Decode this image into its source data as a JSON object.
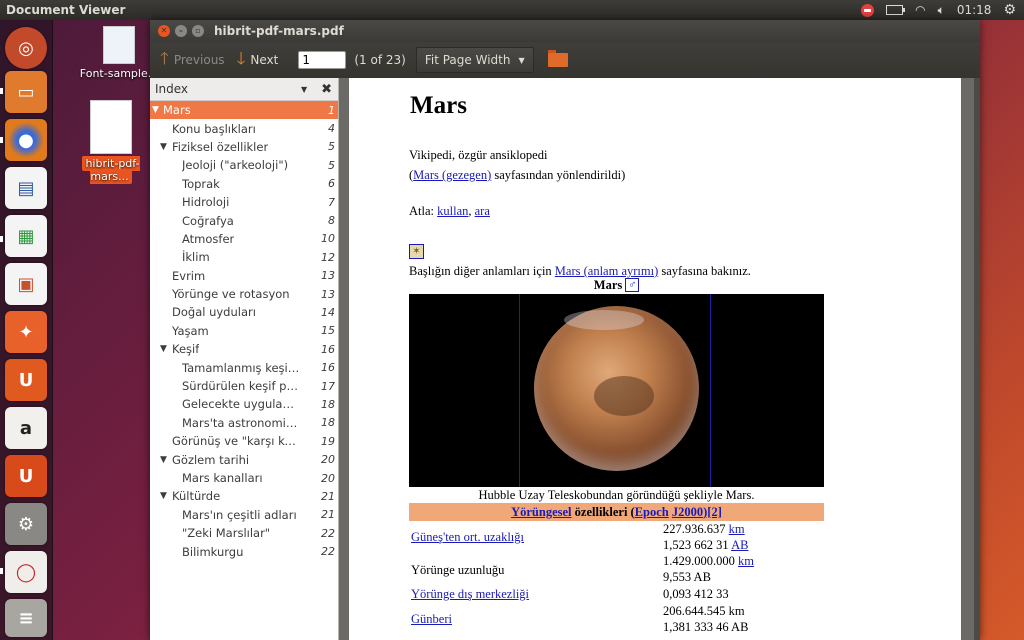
{
  "top_panel": {
    "app_title": "Document Viewer",
    "clock": "01:18"
  },
  "desktop": {
    "icons": [
      {
        "label": "Font-sample..."
      },
      {
        "label": "hibrit-pdf-mars..."
      }
    ]
  },
  "window": {
    "title": "hibrit-pdf-mars.pdf",
    "toolbar": {
      "previous_label": "Previous",
      "next_label": "Next",
      "page_value": "1",
      "page_count": "(1 of 23)",
      "zoom_label": "Fit Page Width"
    },
    "sidebar": {
      "header_label": "Index",
      "items": [
        {
          "label": "Mars",
          "page": "1",
          "level": 0,
          "expander": "▼",
          "selected": true
        },
        {
          "label": "Konu başlıkları",
          "page": "4",
          "level": 1,
          "expander": ""
        },
        {
          "label": "Fiziksel özellikler",
          "page": "5",
          "level": 1,
          "expander": "▼"
        },
        {
          "label": "Jeoloji (\"arkeoloji\")",
          "page": "5",
          "level": 2,
          "expander": ""
        },
        {
          "label": "Toprak",
          "page": "6",
          "level": 2,
          "expander": ""
        },
        {
          "label": "Hidroloji",
          "page": "7",
          "level": 2,
          "expander": ""
        },
        {
          "label": "Coğrafya",
          "page": "8",
          "level": 2,
          "expander": ""
        },
        {
          "label": "Atmosfer",
          "page": "10",
          "level": 2,
          "expander": ""
        },
        {
          "label": "İklim",
          "page": "12",
          "level": 2,
          "expander": ""
        },
        {
          "label": "Evrim",
          "page": "13",
          "level": 1,
          "expander": ""
        },
        {
          "label": "Yörünge ve rotasyon",
          "page": "13",
          "level": 1,
          "expander": ""
        },
        {
          "label": "Doğal uyduları",
          "page": "14",
          "level": 1,
          "expander": ""
        },
        {
          "label": "Yaşam",
          "page": "15",
          "level": 1,
          "expander": ""
        },
        {
          "label": "Keşif",
          "page": "16",
          "level": 1,
          "expander": "▼"
        },
        {
          "label": "Tamamlanmış keşif pr...",
          "page": "16",
          "level": 2,
          "expander": ""
        },
        {
          "label": "Sürdürülen keşif projeleri",
          "page": "17",
          "level": 2,
          "expander": ""
        },
        {
          "label": "Gelecekte uygulanacak ...",
          "page": "18",
          "level": 2,
          "expander": ""
        },
        {
          "label": "Mars'ta astronomi gözl...",
          "page": "18",
          "level": 2,
          "expander": ""
        },
        {
          "label": "Görünüş ve \"karşı konu...",
          "page": "19",
          "level": 1,
          "expander": ""
        },
        {
          "label": "Gözlem tarihi",
          "page": "20",
          "level": 1,
          "expander": "▼"
        },
        {
          "label": "Mars kanalları",
          "page": "20",
          "level": 2,
          "expander": ""
        },
        {
          "label": "Kültürde",
          "page": "21",
          "level": 1,
          "expander": "▼"
        },
        {
          "label": "Mars'ın çeşitli adları",
          "page": "21",
          "level": 2,
          "expander": ""
        },
        {
          "label": "\"Zeki Marslılar\"",
          "page": "22",
          "level": 2,
          "expander": ""
        },
        {
          "label": "Bilimkurgu",
          "page": "22",
          "level": 2,
          "expander": ""
        }
      ]
    },
    "document": {
      "title": "Mars",
      "source": "Vikipedi, özgür ansiklopedi",
      "redirect_open": "(",
      "redirect_link": "Mars (gezegen)",
      "redirect_rest": " sayfasından yönlendirildi)",
      "jump_label": "Atla: ",
      "jump_link1": "kullan",
      "jump_sep": ", ",
      "jump_link2": "ara",
      "disambig_pre": "Başlığın diğer anlamları için ",
      "disambig_link": "Mars (anlam ayrımı)",
      "disambig_post": " sayfasına bakınız.",
      "infobox_title": "Mars",
      "infobox_symbol": "♂",
      "image_caption": "Hubble Uzay Teleskobundan göründüğü şekliyle Mars.",
      "orbit_head": {
        "link1": "Yörüngesel",
        "mid": " özellikleri (",
        "link2": "Epoch",
        "space": " ",
        "link3": "J2000",
        "end": ")[2]"
      },
      "rows": [
        {
          "label": "Güneş'ten ort. uzaklığı",
          "link": true,
          "v1": "227.936.637 ",
          "u1": "km",
          "v2": "1,523 662 31 ",
          "u2": "AB"
        },
        {
          "label": "Yörünge uzunluğu",
          "link": false,
          "v1": "1.429.000.000 ",
          "u1": "km",
          "v2": "9,553 AB",
          "u2": ""
        },
        {
          "label": "Yörünge dış merkezliği",
          "link": true,
          "v1": "0,093 412 33",
          "u1": "",
          "v2": "",
          "u2": ""
        },
        {
          "label": "Günberi",
          "link": true,
          "v1": "206.644.545 km",
          "u1": "",
          "v2": "1,381 333 46 AB",
          "u2": ""
        }
      ]
    }
  },
  "launcher": {
    "items": [
      {
        "name": "ubuntu-dash-icon",
        "color": "#c24a2a"
      },
      {
        "name": "files-icon",
        "color": "#e07a2c"
      },
      {
        "name": "firefox-icon",
        "color": "#d86a1a"
      },
      {
        "name": "writer-icon",
        "color": "#2a5aa8"
      },
      {
        "name": "calc-icon",
        "color": "#2c9a3a"
      },
      {
        "name": "impress-icon",
        "color": "#c8502a"
      },
      {
        "name": "software-center-icon",
        "color": "#e05a2a"
      },
      {
        "name": "ubuntu-one-icon",
        "color": "#e05a20"
      },
      {
        "name": "amazon-icon",
        "color": "#e8e6e0"
      },
      {
        "name": "ubuntu-one-music-icon",
        "color": "#d84a1a"
      },
      {
        "name": "system-settings-icon",
        "color": "#8a8884"
      },
      {
        "name": "document-viewer-icon",
        "color": "#e8e6e0"
      },
      {
        "name": "workspace-switcher-icon",
        "color": "#a8a6a0"
      }
    ]
  }
}
